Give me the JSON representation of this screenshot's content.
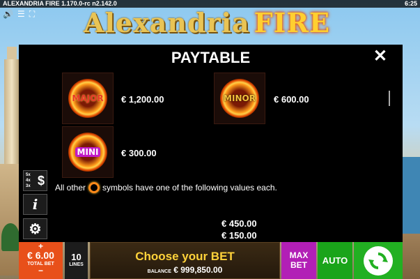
{
  "status_bar": {
    "app_title": "ALEXANDRIA FIRE   1.170.0-rc n2.142.0",
    "clock": "6:25"
  },
  "logo": {
    "part1": "Alexandria",
    "part2": "FIRE"
  },
  "paytable": {
    "title": "PAYTABLE",
    "close_label": "✕",
    "jackpots": [
      {
        "symbol": "MAJOR",
        "value": "€ 1,200.00"
      },
      {
        "symbol": "MINOR",
        "value": "€ 600.00"
      },
      {
        "symbol": "MINI",
        "value": "€ 300.00"
      }
    ],
    "note_before": "All other",
    "note_after": "symbols have one of the following values each.",
    "values": [
      "€ 450.00",
      "€ 150.00"
    ]
  },
  "side_buttons": {
    "paylines_label": "$",
    "info_label": "i",
    "settings_label": "⚙"
  },
  "bottom_bar": {
    "plus": "+",
    "total_bet_amount": "€ 6.00",
    "total_bet_caption": "TOTAL BET",
    "minus": "−",
    "lines_value": "10",
    "lines_caption": "LINES",
    "message": "Choose your BET",
    "balance_caption": "BALANCE",
    "balance_value": "€ 999,850.00",
    "maxbet_line1": "MAX",
    "maxbet_line2": "BET",
    "auto_label": "AUTO"
  },
  "colors": {
    "accent_orange": "#e8501a",
    "max_bet_purple": "#b21fb6",
    "auto_green": "#1aa41a",
    "message_gold": "#ffd23a"
  }
}
